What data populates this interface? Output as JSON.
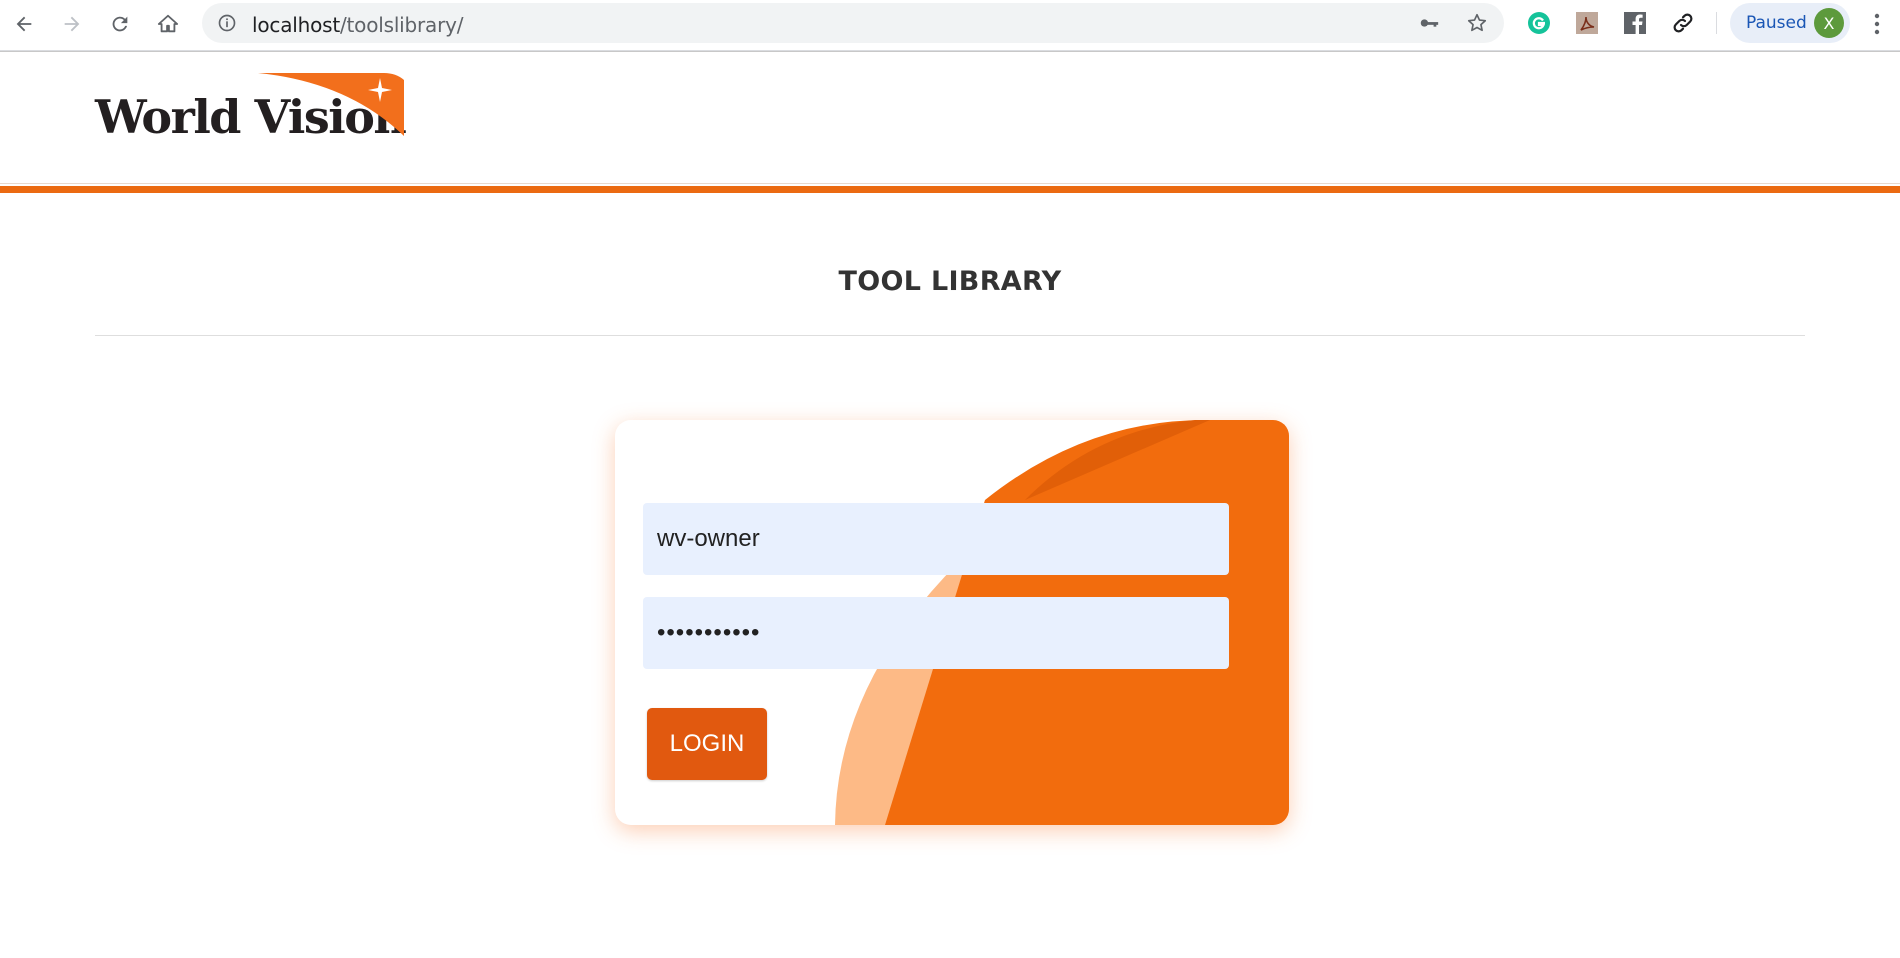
{
  "browser": {
    "url_host": "localhost",
    "url_path": "/toolslibrary/",
    "profile_status": "Paused",
    "profile_initial": "X",
    "icons": [
      "back-icon",
      "forward-icon",
      "reload-icon",
      "home-icon",
      "info-icon",
      "key-icon",
      "star-icon",
      "grammarly-icon",
      "acrobat-icon",
      "facebook-icon",
      "link-icon",
      "menu-icon"
    ]
  },
  "header": {
    "logo_text": "World Vision",
    "brand_color": "#eb6a11"
  },
  "main": {
    "title": "TOOL LIBRARY"
  },
  "login": {
    "username_value": "wv-owner",
    "password_value": "•••••••••••",
    "button_label": "LOGIN",
    "field_bg": "#e8f0fe",
    "button_color": "#e1590f"
  }
}
